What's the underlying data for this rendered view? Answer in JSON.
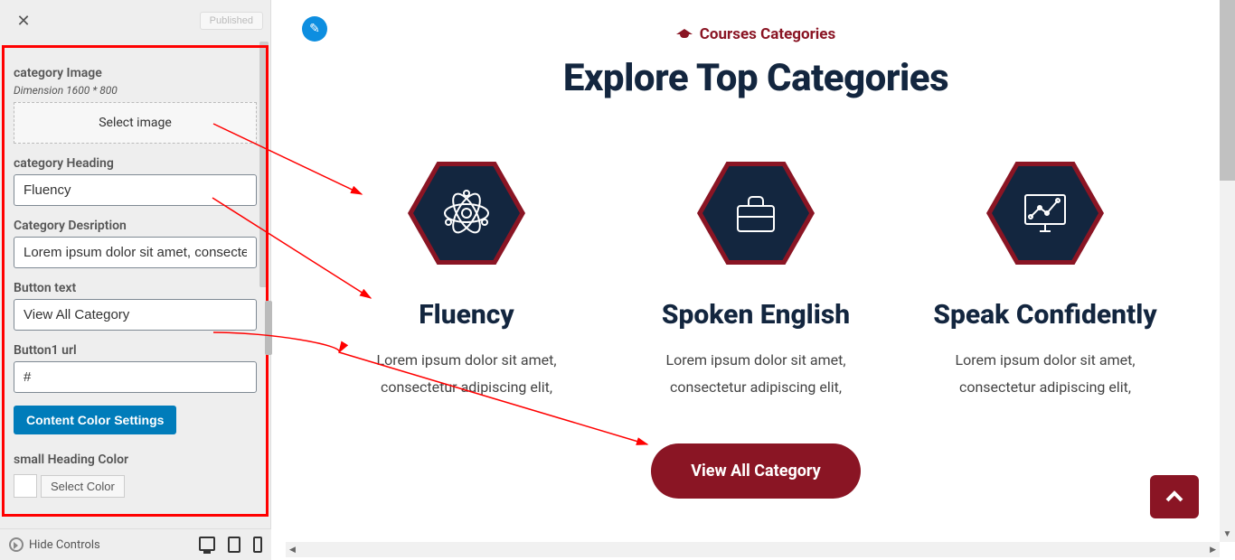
{
  "sidebar": {
    "close_icon": "✕",
    "published_label": "Published",
    "fields": {
      "cat_image_label": "category Image",
      "cat_image_dim": "Dimension 1600 * 800",
      "select_image": "Select image",
      "cat_heading_label": "category Heading",
      "cat_heading_value": "Fluency",
      "cat_desc_label": "Category Desription",
      "cat_desc_value": "Lorem ipsum dolor sit amet, consectetur",
      "btn_text_label": "Button text",
      "btn_text_value": "View All Category",
      "btn_url_label": "Button1 url",
      "btn_url_value": "#",
      "color_settings_btn": "Content Color Settings",
      "small_heading_color_label": "small Heading Color",
      "select_color": "Select Color"
    },
    "footer": {
      "hide_controls": "Hide Controls"
    }
  },
  "preview": {
    "small_title": "Courses Categories",
    "big_title": "Explore Top Categories",
    "cards": [
      {
        "title": "Fluency",
        "desc1": "Lorem ipsum dolor sit amet,",
        "desc2": "consectetur adipiscing elit,"
      },
      {
        "title": "Spoken English",
        "desc1": "Lorem ipsum dolor sit amet,",
        "desc2": "consectetur adipiscing elit,"
      },
      {
        "title": "Speak Confidently",
        "desc1": "Lorem ipsum dolor sit amet,",
        "desc2": "consectetur adipiscing elit,"
      }
    ],
    "view_btn": "View All Category"
  },
  "colors": {
    "brand_red": "#8a1524",
    "brand_navy": "#13263f",
    "wp_blue": "#007cba"
  }
}
